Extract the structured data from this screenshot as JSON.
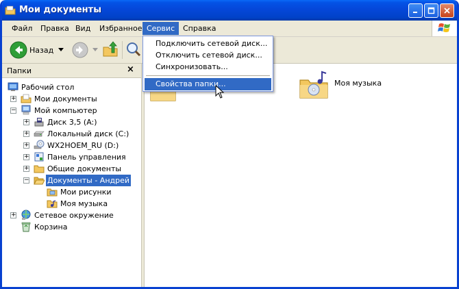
{
  "window": {
    "title": "Мои документы"
  },
  "menubar": {
    "items": [
      "Файл",
      "Правка",
      "Вид",
      "Избранное",
      "Сервис",
      "Справка"
    ],
    "active": "Сервис"
  },
  "toolbar": {
    "back_label": "Назад"
  },
  "service_menu": {
    "items": [
      "Подключить сетевой диск...",
      "Отключить сетевой диск...",
      "Синхронизовать...",
      "Свойства папки..."
    ],
    "highlighted": "Свойства папки..."
  },
  "sidebar": {
    "title": "Папки",
    "close_glyph": "×",
    "tree": [
      {
        "label": "Рабочий стол",
        "icon": "desktop-icon"
      },
      {
        "label": "Мои документы",
        "icon": "documents-folder-icon"
      },
      {
        "label": "Мой компьютер",
        "icon": "computer-icon"
      },
      {
        "label": "Диск 3,5 (A:)",
        "icon": "floppy-drive-icon"
      },
      {
        "label": "Локальный диск (C:)",
        "icon": "hard-drive-icon"
      },
      {
        "label": "WX2HOEM_RU (D:)",
        "icon": "cd-drive-icon"
      },
      {
        "label": "Панель управления",
        "icon": "control-panel-icon"
      },
      {
        "label": "Общие документы",
        "icon": "folder-icon"
      },
      {
        "label": "Документы - Андрей",
        "icon": "open-folder-icon"
      },
      {
        "label": "Мои рисунки",
        "icon": "pictures-folder-icon"
      },
      {
        "label": "Моя музыка",
        "icon": "music-folder-icon"
      },
      {
        "label": "Сетевое окружение",
        "icon": "network-icon"
      },
      {
        "label": "Корзина",
        "icon": "recycle-bin-icon"
      }
    ],
    "selected": "Документы - Андрей"
  },
  "content": {
    "items": [
      {
        "label": "Моя музыка",
        "icon": "music-folder-icon"
      }
    ]
  },
  "colors": {
    "titlebar": "#0547d9",
    "selection": "#316ac5",
    "chrome": "#ece9d8",
    "folder": "#f3c75f"
  }
}
